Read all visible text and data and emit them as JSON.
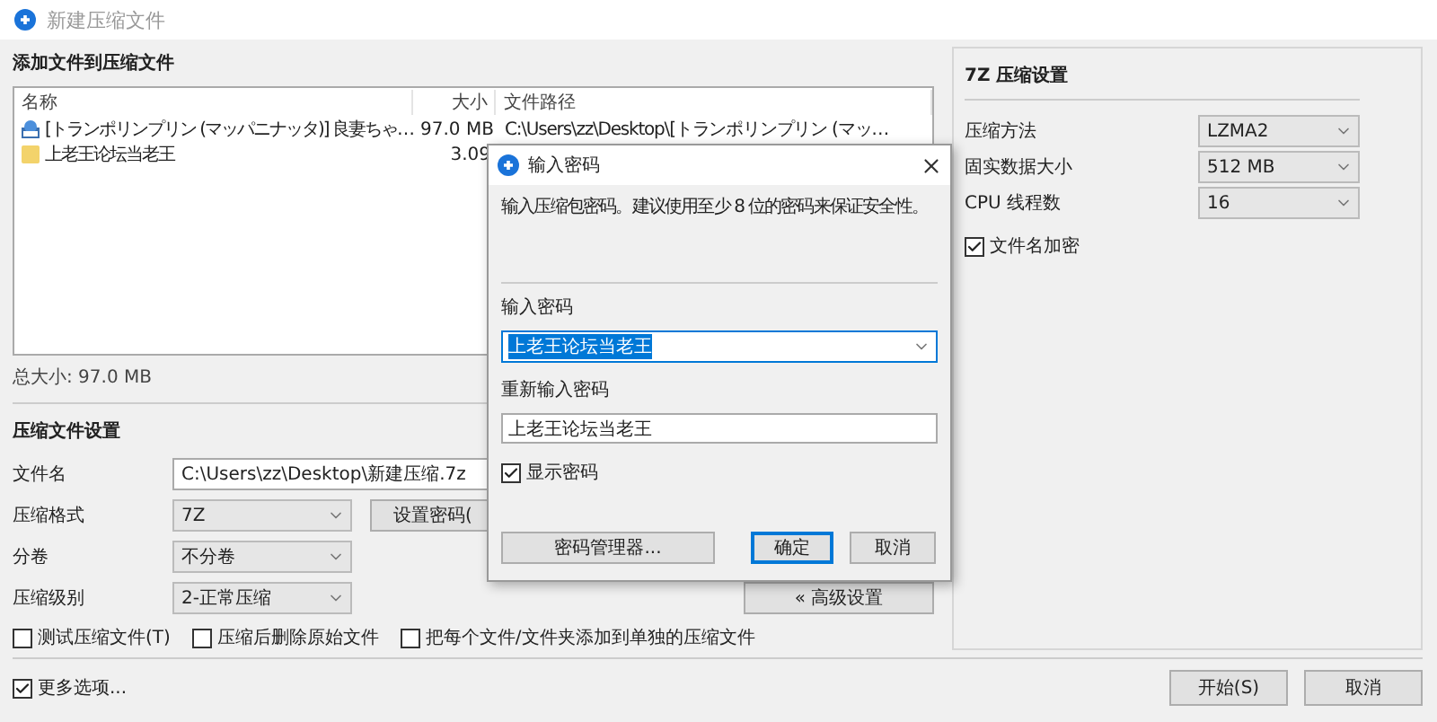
{
  "window": {
    "title": "新建压缩文件"
  },
  "files": {
    "heading": "添加文件到压缩文件",
    "columns": [
      "名称",
      "大小",
      "文件路径"
    ],
    "rows": [
      {
        "kind": "archive",
        "name": "[トランポリンプリン (マッパニナッタ)] 良妻ちゃ…",
        "size": "97.0 MB",
        "path": "C:\\Users\\zz\\Desktop\\[トランポリンプリン (マッ…"
      },
      {
        "kind": "folder",
        "name": "上老王论坛当老王",
        "size": "3.09"
      }
    ]
  },
  "total_size": "总大小: 97.0 MB",
  "settings": {
    "heading": "压缩文件设置",
    "fields": [
      {
        "kind": "text",
        "label": "文件名",
        "value": "C:\\Users\\zz\\Desktop\\新建压缩.7z"
      },
      {
        "kind": "select",
        "label": "压缩格式",
        "value": "7Z"
      },
      {
        "kind": "select",
        "label": "分卷",
        "value": "不分卷"
      },
      {
        "kind": "select",
        "label": "压缩级别",
        "value": "2-正常压缩"
      }
    ],
    "set_password_button": "设置密码(",
    "advanced_button": "« 高级设置",
    "options": [
      {
        "label": "测试压缩文件(T)",
        "checked": false
      },
      {
        "label": "压缩后删除原始文件",
        "checked": false
      },
      {
        "label": "把每个文件/文件夹添加到单独的压缩文件",
        "checked": false
      }
    ]
  },
  "more_options": {
    "label": "更多选项...",
    "checked": true
  },
  "buttons": [
    "开始(S)",
    "取消"
  ],
  "seven_z": {
    "heading": "7Z 压缩设置",
    "fields": [
      {
        "label": "压缩方法",
        "value": "LZMA2"
      },
      {
        "label": "固实数据大小",
        "value": "512 MB"
      },
      {
        "label": "CPU 线程数",
        "value": "16"
      }
    ],
    "encrypt_names": {
      "label": "文件名加密",
      "checked": true
    }
  },
  "dialog": {
    "title": "输入密码",
    "hint": "输入压缩包密码。建议使用至少 8 位的密码来保证安全性。",
    "password_label": "输入密码",
    "password": "上老王论坛当老王",
    "confirm_label": "重新输入密码",
    "confirm": "上老王论坛当老王",
    "show_password": {
      "label": "显示密码",
      "checked": true
    },
    "manager_button": "密码管理器...",
    "ok_button": "确定",
    "cancel_button": "取消"
  }
}
